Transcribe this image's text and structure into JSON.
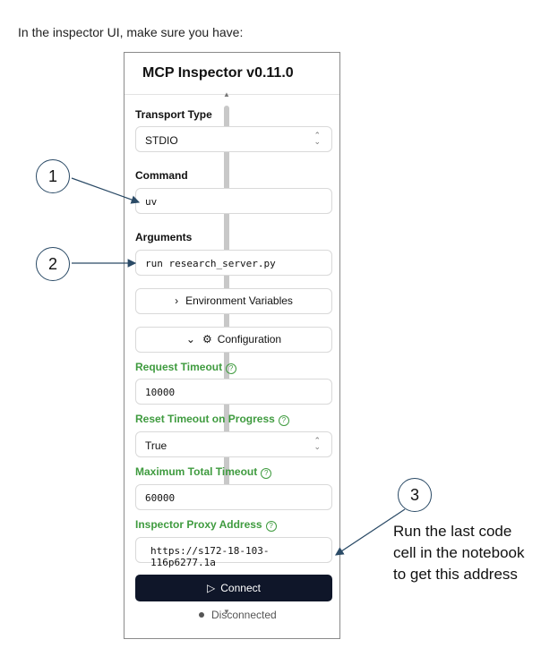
{
  "intro": "In the inspector UI, make sure you have:",
  "panel": {
    "title": "MCP Inspector v0.11.0",
    "transport_label": "Transport Type",
    "transport_value": "STDIO",
    "command_label": "Command",
    "command_value": "uv",
    "arguments_label": "Arguments",
    "arguments_value": "run research_server.py",
    "env_button": "Environment Variables",
    "config_button": "Configuration",
    "request_timeout_label": "Request Timeout",
    "request_timeout_value": "10000",
    "reset_timeout_label": "Reset Timeout on Progress",
    "reset_timeout_value": "True",
    "max_timeout_label": "Maximum Total Timeout",
    "max_timeout_value": "60000",
    "proxy_label": "Inspector Proxy Address",
    "proxy_value": "https://s172-18-103-116p6277.1a",
    "connect_button": "Connect",
    "status": "Disconnected"
  },
  "callouts": {
    "one": "1",
    "two": "2",
    "three": "3",
    "note": "Run the last code cell in the notebook to get this address"
  },
  "colors": {
    "accent_green": "#3f9b3f",
    "button_dark": "#0f1629",
    "arrow": "#2a4a66"
  },
  "icons": [
    "chevron-right-icon",
    "chevron-down-icon",
    "gear-icon",
    "help-circle-icon",
    "play-icon",
    "updown-icon"
  ]
}
